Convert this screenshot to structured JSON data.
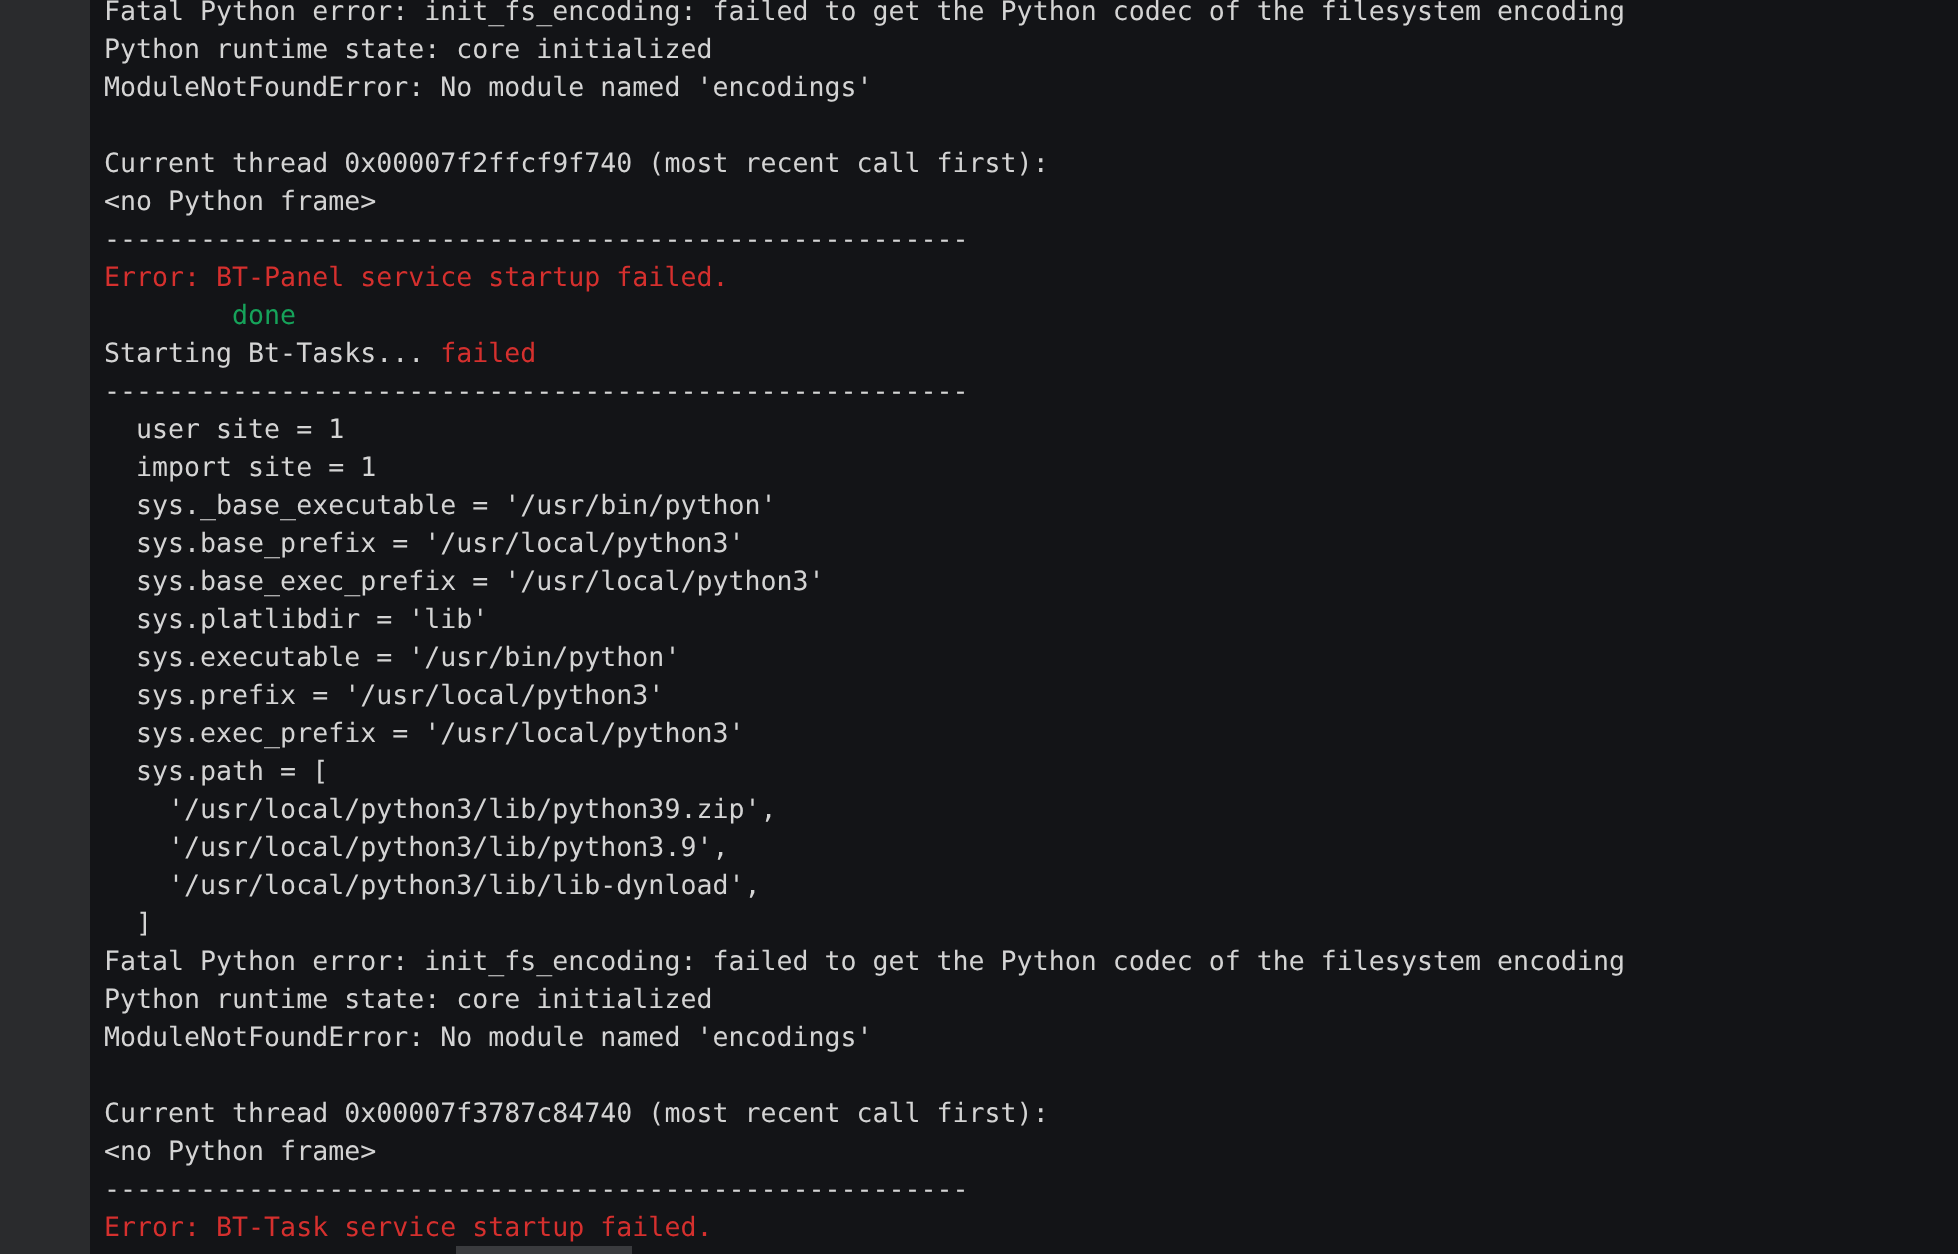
{
  "lines": [
    {
      "kind": "text",
      "segments": [
        {
          "text": "Fatal Python error: init_fs_encoding: failed to get the Python codec of the filesystem encoding",
          "color": "#d4d4d4"
        }
      ]
    },
    {
      "kind": "text",
      "segments": [
        {
          "text": "Python runtime state: core initialized",
          "color": "#d4d4d4"
        }
      ]
    },
    {
      "kind": "text",
      "segments": [
        {
          "text": "ModuleNotFoundError: No module named 'encodings'",
          "color": "#d4d4d4"
        }
      ]
    },
    {
      "kind": "blank"
    },
    {
      "kind": "text",
      "segments": [
        {
          "text": "Current thread 0x00007f2ffcf9f740 (most recent call first):",
          "color": "#d4d4d4"
        }
      ]
    },
    {
      "kind": "text",
      "segments": [
        {
          "text": "<no Python frame>",
          "color": "#d4d4d4"
        }
      ]
    },
    {
      "kind": "text",
      "segments": [
        {
          "text": "------------------------------------------------------",
          "color": "#d4d4d4"
        }
      ]
    },
    {
      "kind": "text",
      "segments": [
        {
          "text": "Error: BT-Panel service startup failed.",
          "color": "#d5302e"
        }
      ]
    },
    {
      "kind": "text",
      "segments": [
        {
          "text": "        done",
          "color": "#16a35a"
        }
      ]
    },
    {
      "kind": "text",
      "segments": [
        {
          "text": "Starting Bt-Tasks... ",
          "color": "#d4d4d4"
        },
        {
          "text": "failed",
          "color": "#d5302e"
        }
      ]
    },
    {
      "kind": "text",
      "segments": [
        {
          "text": "------------------------------------------------------",
          "color": "#d4d4d4"
        }
      ]
    },
    {
      "kind": "text",
      "segments": [
        {
          "text": "  user site = 1",
          "color": "#d4d4d4"
        }
      ]
    },
    {
      "kind": "text",
      "segments": [
        {
          "text": "  import site = 1",
          "color": "#d4d4d4"
        }
      ]
    },
    {
      "kind": "text",
      "segments": [
        {
          "text": "  sys._base_executable = '/usr/bin/python'",
          "color": "#d4d4d4"
        }
      ]
    },
    {
      "kind": "text",
      "segments": [
        {
          "text": "  sys.base_prefix = '/usr/local/python3'",
          "color": "#d4d4d4"
        }
      ]
    },
    {
      "kind": "text",
      "segments": [
        {
          "text": "  sys.base_exec_prefix = '/usr/local/python3'",
          "color": "#d4d4d4"
        }
      ]
    },
    {
      "kind": "text",
      "segments": [
        {
          "text": "  sys.platlibdir = 'lib'",
          "color": "#d4d4d4"
        }
      ]
    },
    {
      "kind": "text",
      "segments": [
        {
          "text": "  sys.executable = '/usr/bin/python'",
          "color": "#d4d4d4"
        }
      ]
    },
    {
      "kind": "text",
      "segments": [
        {
          "text": "  sys.prefix = '/usr/local/python3'",
          "color": "#d4d4d4"
        }
      ]
    },
    {
      "kind": "text",
      "segments": [
        {
          "text": "  sys.exec_prefix = '/usr/local/python3'",
          "color": "#d4d4d4"
        }
      ]
    },
    {
      "kind": "text",
      "segments": [
        {
          "text": "  sys.path = [",
          "color": "#d4d4d4"
        }
      ]
    },
    {
      "kind": "text",
      "segments": [
        {
          "text": "    '/usr/local/python3/lib/python39.zip',",
          "color": "#d4d4d4"
        }
      ]
    },
    {
      "kind": "text",
      "segments": [
        {
          "text": "    '/usr/local/python3/lib/python3.9',",
          "color": "#d4d4d4"
        }
      ]
    },
    {
      "kind": "text",
      "segments": [
        {
          "text": "    '/usr/local/python3/lib/lib-dynload',",
          "color": "#d4d4d4"
        }
      ]
    },
    {
      "kind": "text",
      "segments": [
        {
          "text": "  ]",
          "color": "#d4d4d4"
        }
      ]
    },
    {
      "kind": "text",
      "segments": [
        {
          "text": "Fatal Python error: init_fs_encoding: failed to get the Python codec of the filesystem encoding",
          "color": "#d4d4d4"
        }
      ]
    },
    {
      "kind": "text",
      "segments": [
        {
          "text": "Python runtime state: core initialized",
          "color": "#d4d4d4"
        }
      ]
    },
    {
      "kind": "text",
      "segments": [
        {
          "text": "ModuleNotFoundError: No module named 'encodings'",
          "color": "#d4d4d4"
        }
      ]
    },
    {
      "kind": "blank"
    },
    {
      "kind": "text",
      "segments": [
        {
          "text": "Current thread 0x00007f3787c84740 (most recent call first):",
          "color": "#d4d4d4"
        }
      ]
    },
    {
      "kind": "text",
      "segments": [
        {
          "text": "<no Python frame>",
          "color": "#d4d4d4"
        }
      ]
    },
    {
      "kind": "text",
      "segments": [
        {
          "text": "------------------------------------------------------",
          "color": "#d4d4d4"
        }
      ]
    },
    {
      "kind": "text",
      "segments": [
        {
          "text": "Error: BT-Task service startup failed.",
          "color": "#d5302e"
        }
      ]
    }
  ]
}
